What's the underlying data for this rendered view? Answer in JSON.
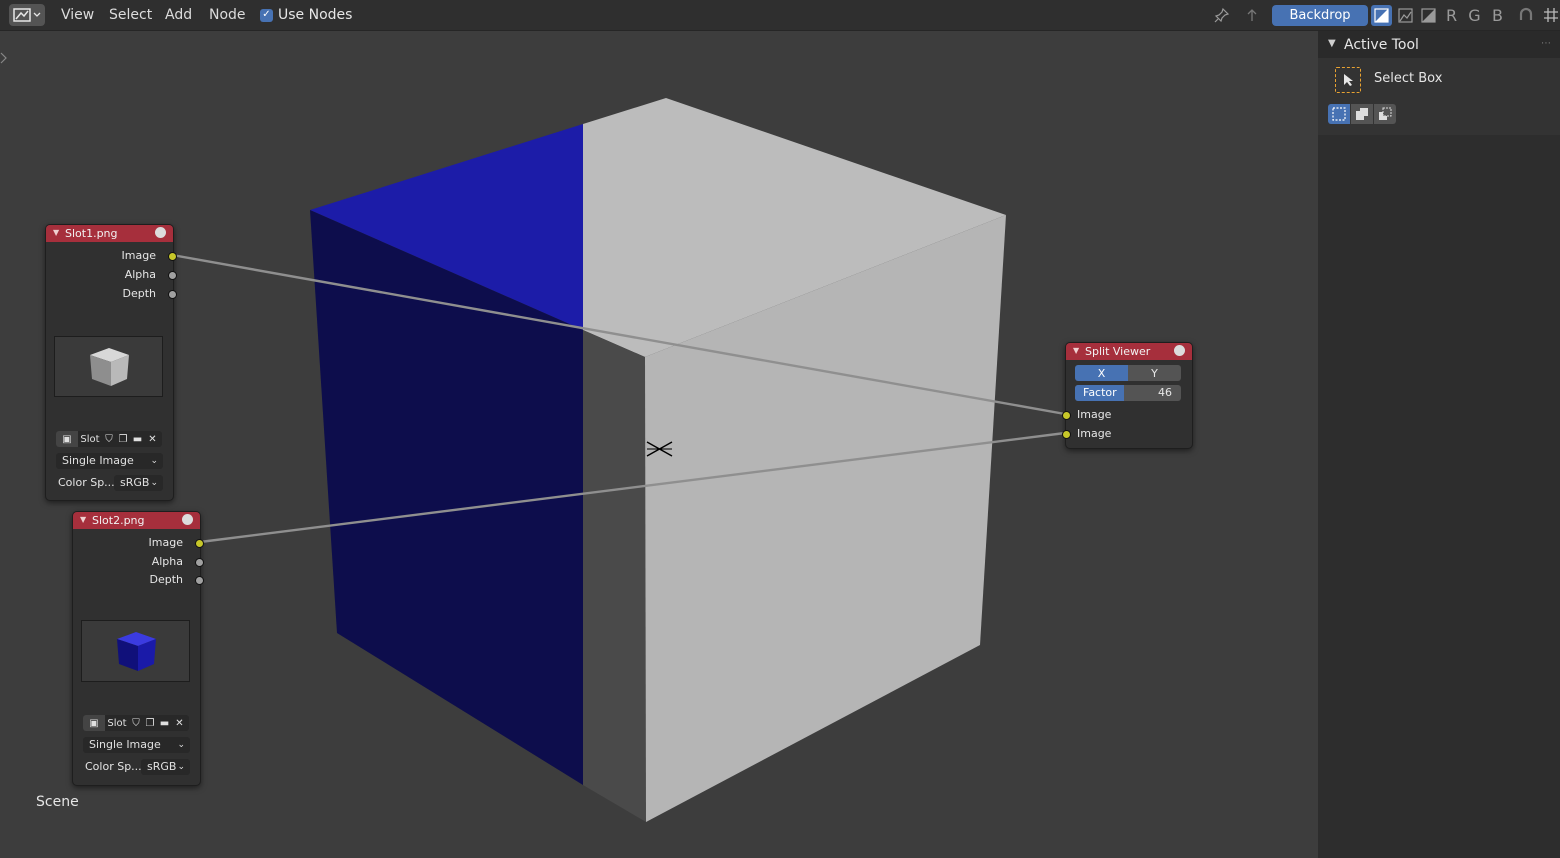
{
  "header": {
    "editor_type_icon": "node-editor-icon",
    "menus": [
      "View",
      "Select",
      "Add",
      "Node"
    ],
    "use_nodes_label": "Use Nodes",
    "use_nodes_checked": true,
    "backdrop_label": "Backdrop",
    "channels": [
      "R",
      "G",
      "B"
    ]
  },
  "side_panel": {
    "title": "Active Tool",
    "tool_label": "Select Box"
  },
  "viewport": {
    "scene_label": "Scene"
  },
  "nodes": {
    "slot1": {
      "title": "Slot1.png",
      "outputs": [
        "Image",
        "Alpha",
        "Depth"
      ],
      "slot_label": "Slot",
      "source": "Single Image",
      "color_space_label": "Color Sp...",
      "color_space": "sRGB"
    },
    "slot2": {
      "title": "Slot2.png",
      "outputs": [
        "Image",
        "Alpha",
        "Depth"
      ],
      "slot_label": "Slot",
      "source": "Single Image",
      "color_space_label": "Color Sp...",
      "color_space": "sRGB"
    },
    "split_viewer": {
      "title": "Split Viewer",
      "axis_x": "X",
      "axis_y": "Y",
      "axis_selected": "X",
      "factor_label": "Factor",
      "factor_value": "46",
      "factor_fraction": 0.46,
      "inputs": [
        "Image",
        "Image"
      ]
    }
  },
  "colors": {
    "accent": "#4772b3",
    "node_header": "#a62f3c",
    "socket_image": "#c7c729",
    "socket_value": "#a1a1a1",
    "cube_blue": "#1c1ca8",
    "cube_gray": "#bcbcbc"
  }
}
